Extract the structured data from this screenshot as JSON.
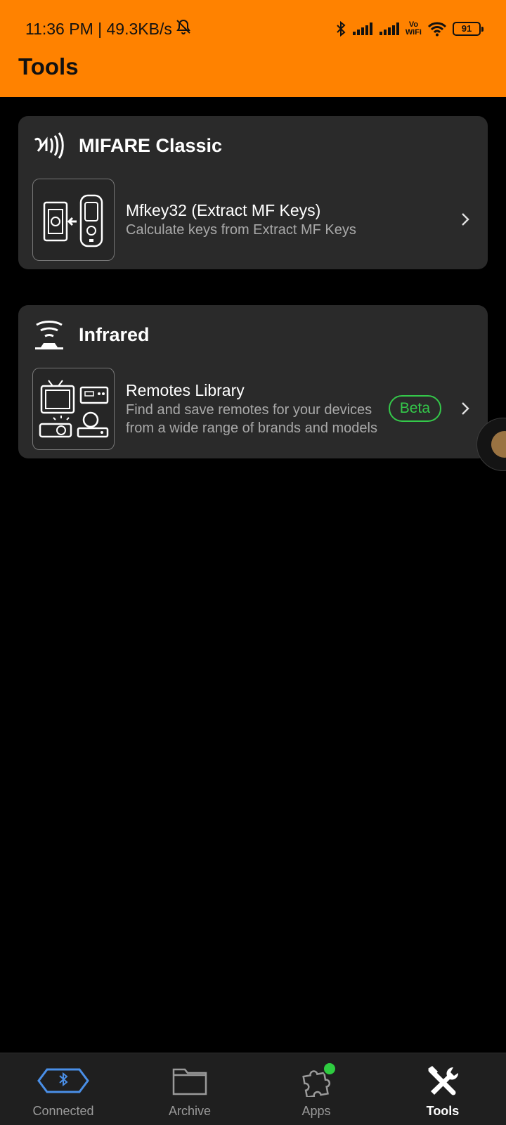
{
  "status_bar": {
    "time_speed": "11:36 PM | 49.3KB/s",
    "vowifi_top": "Vo",
    "vowifi_bottom": "WiFi",
    "battery": "91"
  },
  "header": {
    "title": "Tools"
  },
  "sections": [
    {
      "title": "MIFARE Classic",
      "icon": "nfc-icon",
      "tool": {
        "name": "Mfkey32 (Extract MF Keys)",
        "description": "Calculate keys from Extract MF Keys",
        "icon": "card-reader-icon"
      }
    },
    {
      "title": "Infrared",
      "icon": "infrared-icon",
      "tool": {
        "name": "Remotes Library",
        "description": "Find and save remotes for your devices from a wide range of brands and models",
        "badge": "Beta",
        "icon": "devices-icon"
      }
    }
  ],
  "bottom_nav": [
    {
      "label": "Connected",
      "icon": "bluetooth-device-icon"
    },
    {
      "label": "Archive",
      "icon": "folder-icon"
    },
    {
      "label": "Apps",
      "icon": "puzzle-icon"
    },
    {
      "label": "Tools",
      "icon": "tools-icon",
      "active": true
    }
  ],
  "colors": {
    "accent": "#ff8200",
    "badge": "#34c94a",
    "card_bg": "#2a2a2a",
    "connected_icon": "#4a8fe7"
  }
}
